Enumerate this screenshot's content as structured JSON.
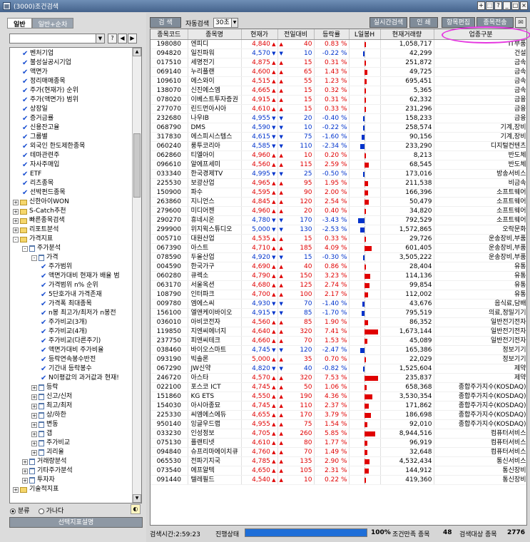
{
  "window": {
    "title": "(3000)조건검색",
    "buttons": [
      "+",
      "⬚",
      "?",
      "_",
      "□",
      "×"
    ]
  },
  "left": {
    "tabs": [
      "일반",
      "일반+순차"
    ],
    "tree": [
      {
        "type": "chk",
        "label": "벤처기업",
        "indent": 1
      },
      {
        "type": "chk",
        "label": "불성실공시기업",
        "indent": 1
      },
      {
        "type": "chk",
        "label": "액면가",
        "indent": 1
      },
      {
        "type": "chk",
        "label": "정리매매종목",
        "indent": 1
      },
      {
        "type": "chk",
        "label": "주가(현재가) 순위",
        "indent": 1
      },
      {
        "type": "chk",
        "label": "주가(액면가) 범위",
        "indent": 1
      },
      {
        "type": "chk",
        "label": "상장일",
        "indent": 1
      },
      {
        "type": "chk",
        "label": "증거금률",
        "indent": 1
      },
      {
        "type": "chk",
        "label": "신용잔고율",
        "indent": 1
      },
      {
        "type": "chk",
        "label": "그룹별",
        "indent": 1
      },
      {
        "type": "chk",
        "label": "외국인 한도제한종목",
        "indent": 1
      },
      {
        "type": "chk",
        "label": "테마관련주",
        "indent": 1
      },
      {
        "type": "chk",
        "label": "자사주매입",
        "indent": 1
      },
      {
        "type": "chk",
        "label": "ETF",
        "indent": 1
      },
      {
        "type": "chk",
        "label": "리츠종목",
        "indent": 1
      },
      {
        "type": "chk",
        "label": "선박펀드종목",
        "indent": 1
      },
      {
        "type": "fold",
        "label": "신한아이WON",
        "indent": 0,
        "pm": "+"
      },
      {
        "type": "fold",
        "label": "S-Catch추천",
        "indent": 0,
        "pm": "+"
      },
      {
        "type": "fold",
        "label": "빠른종목검색",
        "indent": 0,
        "pm": "+"
      },
      {
        "type": "fold",
        "label": "리포트분석",
        "indent": 0,
        "pm": "+"
      },
      {
        "type": "fold",
        "label": "가격지표",
        "indent": 0,
        "pm": "-"
      },
      {
        "type": "doc",
        "label": "주가분석",
        "indent": 1,
        "pm": "-"
      },
      {
        "type": "doc",
        "label": "가격",
        "indent": 2,
        "pm": "-"
      },
      {
        "type": "chk",
        "label": "주가범위",
        "indent": 3
      },
      {
        "type": "chk",
        "label": "액면가대비 현재가 배율 범",
        "indent": 3
      },
      {
        "type": "chk",
        "label": "가격범위 n% 순위",
        "indent": 3
      },
      {
        "type": "chk",
        "label": "5단호가내 가격존재",
        "indent": 3
      },
      {
        "type": "chk",
        "label": "가격폭 최대종목",
        "indent": 3
      },
      {
        "type": "chk",
        "label": "n봉 최고가/최저가 n봉전",
        "indent": 3
      },
      {
        "type": "chk",
        "label": "주가비교(3개)",
        "indent": 3
      },
      {
        "type": "chk",
        "label": "주가비교(4개)",
        "indent": 3
      },
      {
        "type": "chk",
        "label": "주가비교(다른주기)",
        "indent": 3
      },
      {
        "type": "chk",
        "label": "액면가대비 주가비율",
        "indent": 3
      },
      {
        "type": "chk",
        "label": "등락연속봉수반전",
        "indent": 3
      },
      {
        "type": "chk",
        "label": "기간내 등락봉수",
        "indent": 3
      },
      {
        "type": "chk",
        "label": "N이평값의 과거값과 현재!",
        "indent": 3
      },
      {
        "type": "doc",
        "label": "등락",
        "indent": 2,
        "pm": "+"
      },
      {
        "type": "doc",
        "label": "신고/신저",
        "indent": 2,
        "pm": "+"
      },
      {
        "type": "doc",
        "label": "최고/최저",
        "indent": 2,
        "pm": "+"
      },
      {
        "type": "doc",
        "label": "상/하한",
        "indent": 2,
        "pm": "+"
      },
      {
        "type": "doc",
        "label": "변동",
        "indent": 2,
        "pm": "+"
      },
      {
        "type": "doc",
        "label": "갭",
        "indent": 2,
        "pm": "+"
      },
      {
        "type": "doc",
        "label": "주가비교",
        "indent": 2,
        "pm": "+"
      },
      {
        "type": "doc",
        "label": "괴리율",
        "indent": 2,
        "pm": "+"
      },
      {
        "type": "doc",
        "label": "거래량분석",
        "indent": 1,
        "pm": "+"
      },
      {
        "type": "doc",
        "label": "기타주가분석",
        "indent": 1,
        "pm": "+"
      },
      {
        "type": "doc",
        "label": "투자자",
        "indent": 1,
        "pm": "+"
      },
      {
        "type": "fold",
        "label": "기술적지표",
        "indent": 0,
        "pm": "+"
      }
    ],
    "radio": {
      "option1": "분류",
      "option2": "가나다",
      "selected": "분류"
    },
    "desc_button": "선택지표설명"
  },
  "toolbar": {
    "search_btn": "검 색",
    "auto_label": "자동검색",
    "auto_value": "30초",
    "realtime_btn": "실시간검색",
    "print_btn": "인 쇄",
    "edit_btn": "항목편집",
    "send_btn": "종목전송"
  },
  "columns": [
    "종목코드",
    "종목명",
    "현재가",
    "전일대비",
    "등락률",
    "L일봉H",
    "현재거래량",
    "업종구분"
  ],
  "rows": [
    [
      "198080",
      "엔피디",
      "4,840",
      "up",
      "40",
      "0.83 %",
      "1,058,717",
      "IT부품"
    ],
    [
      "094820",
      "일진파워",
      "4,570",
      "down",
      "10",
      "-0.22 %",
      "42,299",
      "건설"
    ],
    [
      "017510",
      "세명전기",
      "4,875",
      "up",
      "15",
      "0.31 %",
      "251,872",
      "금속"
    ],
    [
      "069140",
      "누리플랜",
      "4,600",
      "up",
      "65",
      "1.43 %",
      "49,725",
      "금속"
    ],
    [
      "109610",
      "에스와이",
      "4,515",
      "up",
      "55",
      "1.23 %",
      "695,451",
      "금속"
    ],
    [
      "138070",
      "신진에스엠",
      "4,665",
      "up",
      "15",
      "0.32 %",
      "5,365",
      "금속"
    ],
    [
      "078020",
      "이베스트투자증권",
      "4,915",
      "up",
      "15",
      "0.31 %",
      "62,332",
      "금융"
    ],
    [
      "277070",
      "린드먼아시아",
      "4,610",
      "up",
      "15",
      "0.33 %",
      "231,296",
      "금융"
    ],
    [
      "232680",
      "나우IB",
      "4,955",
      "down",
      "20",
      "-0.40 %",
      "158,233",
      "금융"
    ],
    [
      "068790",
      "DMS",
      "4,590",
      "down",
      "10",
      "-0.22 %",
      "258,574",
      "기계,장비"
    ],
    [
      "317830",
      "에스피시스템스",
      "4,615",
      "down",
      "75",
      "-1.60 %",
      "90,156",
      "기계,장비"
    ],
    [
      "060240",
      "룽투코리아",
      "4,585",
      "down",
      "110",
      "-2.34 %",
      "233,290",
      "디지털컨텐츠"
    ],
    [
      "062860",
      "티엘아이",
      "4,960",
      "up",
      "10",
      "0.20 %",
      "8,213",
      "반도체"
    ],
    [
      "096610",
      "알에프세미",
      "4,560",
      "up",
      "115",
      "2.59 %",
      "68,545",
      "반도체"
    ],
    [
      "033340",
      "한국경제TV",
      "4,995",
      "down",
      "25",
      "-0.50 %",
      "173,016",
      "방송서비스"
    ],
    [
      "225530",
      "보광산업",
      "4,965",
      "up",
      "95",
      "1.95 %",
      "211,538",
      "비금속"
    ],
    [
      "150900",
      "파수",
      "4,595",
      "up",
      "90",
      "2.00 %",
      "166,396",
      "소프트웨어"
    ],
    [
      "263860",
      "지니언스",
      "4,845",
      "up",
      "120",
      "2.54 %",
      "50,479",
      "소프트웨어"
    ],
    [
      "279600",
      "미디어젠",
      "4,960",
      "up",
      "20",
      "0.40 %",
      "34,820",
      "소프트웨어"
    ],
    [
      "290270",
      "휴네시온",
      "4,780",
      "down",
      "170",
      "-3.43 %",
      "792,529",
      "소프트웨어"
    ],
    [
      "299900",
      "위지윅스튜디오",
      "5,000",
      "down",
      "130",
      "-2.53 %",
      "1,572,865",
      "오락문화"
    ],
    [
      "005710",
      "대원산업",
      "4,535",
      "up",
      "15",
      "0.33 %",
      "29,726",
      "운송장비,부품"
    ],
    [
      "067390",
      "아스트",
      "4,710",
      "up",
      "185",
      "4.09 %",
      "601,405",
      "운송장비,부품"
    ],
    [
      "078590",
      "두올산업",
      "4,920",
      "down",
      "15",
      "-0.30 %",
      "3,505,222",
      "운송장비,부품"
    ],
    [
      "004590",
      "한국가구",
      "4,690",
      "up",
      "40",
      "0.86 %",
      "28,404",
      "유통"
    ],
    [
      "060280",
      "큐렉소",
      "4,790",
      "up",
      "150",
      "3.23 %",
      "114,136",
      "유통"
    ],
    [
      "063170",
      "서울옥션",
      "4,680",
      "up",
      "125",
      "2.74 %",
      "99,854",
      "유통"
    ],
    [
      "108790",
      "인터파크",
      "4,700",
      "up",
      "100",
      "2.17 %",
      "112,002",
      "유통"
    ],
    [
      "009780",
      "엠에스씨",
      "4,930",
      "down",
      "70",
      "-1.40 %",
      "43,676",
      "음식료,담배"
    ],
    [
      "156100",
      "엘앤케이바이오",
      "4,915",
      "down",
      "85",
      "-1.70 %",
      "795,519",
      "의료,정밀기기"
    ],
    [
      "036010",
      "아비코전자",
      "4,560",
      "up",
      "85",
      "1.90 %",
      "86,352",
      "일반전기전자"
    ],
    [
      "119850",
      "지엔씨에너지",
      "4,640",
      "up",
      "320",
      "7.41 %",
      "1,673,144",
      "일반전기전자"
    ],
    [
      "237750",
      "피앤씨테크",
      "4,660",
      "up",
      "70",
      "1.53 %",
      "45,089",
      "일반전기전자"
    ],
    [
      "038460",
      "바이오스마트",
      "4,745",
      "down",
      "120",
      "-2.47 %",
      "165,386",
      "정보기기"
    ],
    [
      "093190",
      "빅솔론",
      "5,000",
      "up",
      "35",
      "0.70 %",
      "22,029",
      "정보기기"
    ],
    [
      "067290",
      "JW신약",
      "4,820",
      "down",
      "40",
      "-0.82 %",
      "1,525,604",
      "제약"
    ],
    [
      "246720",
      "아스타",
      "4,570",
      "up",
      "320",
      "7.53 %",
      "235,837",
      "제약"
    ],
    [
      "022100",
      "포스코 ICT",
      "4,745",
      "up",
      "50",
      "1.06 %",
      "658,368",
      "종합주가지수(KOSDAQ)"
    ],
    [
      "151860",
      "KG ETS",
      "4,550",
      "up",
      "190",
      "4.36 %",
      "3,530,354",
      "종합주가지수(KOSDAQ)"
    ],
    [
      "154030",
      "아시아종묘",
      "4,745",
      "up",
      "110",
      "2.37 %",
      "171,862",
      "종합주가지수(KOSDAQ)"
    ],
    [
      "225330",
      "씨엠에스에듀",
      "4,655",
      "up",
      "170",
      "3.79 %",
      "186,698",
      "종합주가지수(KOSDAQ)"
    ],
    [
      "950140",
      "잉글우드랩",
      "4,955",
      "up",
      "75",
      "1.54 %",
      "92,010",
      "종합주가지수(KOSDAQ)"
    ],
    [
      "033230",
      "인성정보",
      "4,705",
      "up",
      "260",
      "5.85 %",
      "8,944,516",
      "컴퓨터서비스"
    ],
    [
      "075130",
      "플랜티넷",
      "4,610",
      "up",
      "80",
      "1.77 %",
      "96,919",
      "컴퓨터서비스"
    ],
    [
      "094840",
      "슈프리마에이치큐",
      "4,760",
      "up",
      "70",
      "1.49 %",
      "32,648",
      "컴퓨터서비스"
    ],
    [
      "065530",
      "전파기지국",
      "4,785",
      "up",
      "135",
      "2.90 %",
      "4,532,434",
      "통신서비스"
    ],
    [
      "073540",
      "에프알텍",
      "4,650",
      "up",
      "105",
      "2.31 %",
      "144,912",
      "통신장비"
    ],
    [
      "091440",
      "텔레필드",
      "4,540",
      "up",
      "10",
      "0.22 %",
      "419,360",
      "통신장비"
    ]
  ],
  "status": {
    "search_time": "검색시간:2:59:23",
    "progress_label": "진행상태",
    "progress_pct": "100%",
    "progress_value": 100,
    "matched_label": "조건만족 종목",
    "matched_count": "48",
    "target_label": "검색대상 종목",
    "target_count": "2776"
  },
  "colors": {
    "up": "#e00000",
    "down": "#0033cc",
    "highlight": "#e536e0",
    "progress": "#1e6ed8"
  }
}
